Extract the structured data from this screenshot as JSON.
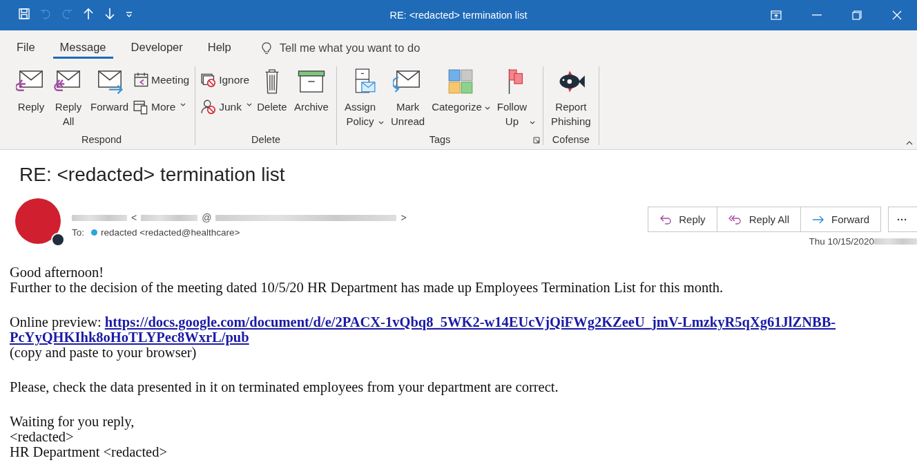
{
  "window": {
    "title": "RE: <redacted> termination list"
  },
  "quick_access": [
    {
      "kind": "save",
      "disabled": false
    },
    {
      "kind": "undo",
      "disabled": true
    },
    {
      "kind": "redo",
      "disabled": true
    },
    {
      "kind": "up",
      "disabled": false
    },
    {
      "kind": "down",
      "disabled": false
    },
    {
      "kind": "customize",
      "disabled": false
    }
  ],
  "menu_tabs": [
    {
      "label": "File",
      "selected": false
    },
    {
      "label": "Message",
      "selected": true
    },
    {
      "label": "Developer",
      "selected": false
    },
    {
      "label": "Help",
      "selected": false
    }
  ],
  "tell_me": {
    "placeholder": "Tell me what you want to do"
  },
  "ribbon_groups": [
    {
      "label": "Respond",
      "has_launcher": false,
      "items": [
        {
          "kind": "large",
          "label": "Reply",
          "dropdown": false
        },
        {
          "kind": "large",
          "label": "Reply All",
          "dropdown": false
        },
        {
          "kind": "large",
          "label": "Forward",
          "dropdown": false
        },
        {
          "kind": "stack",
          "items": [
            {
              "label": "Meeting",
              "dropdown": false
            },
            {
              "label": "More",
              "dropdown": true
            }
          ]
        }
      ]
    },
    {
      "label": "Delete",
      "has_launcher": false,
      "items": [
        {
          "kind": "stack",
          "items": [
            {
              "label": "Ignore",
              "dropdown": false
            },
            {
              "label": "Junk",
              "dropdown": true
            }
          ]
        },
        {
          "kind": "large",
          "label": "Delete",
          "dropdown": false
        },
        {
          "kind": "large",
          "label": "Archive",
          "dropdown": false
        }
      ]
    },
    {
      "label": "Tags",
      "has_launcher": true,
      "items": [
        {
          "kind": "large",
          "label": "Assign Policy",
          "dropdown": true
        },
        {
          "kind": "large",
          "label": "Mark Unread",
          "dropdown": false
        },
        {
          "kind": "large",
          "label": "Categorize",
          "dropdown": true
        },
        {
          "kind": "large",
          "label": "Follow Up",
          "dropdown": true
        }
      ]
    },
    {
      "label": "Cofense",
      "has_launcher": false,
      "items": [
        {
          "kind": "large",
          "label": "Report Phishing",
          "dropdown": false
        }
      ]
    }
  ],
  "message": {
    "subject": "RE: <redacted> termination list",
    "sender_symbols": [
      "<",
      "@",
      ">"
    ],
    "to_label": "To:",
    "recipient": {
      "name": "redacted <redacted@healthcare>",
      "color": "#2ea3e0"
    },
    "actions": [
      {
        "kind": "reply",
        "label": "Reply"
      },
      {
        "kind": "reply_all",
        "label": "Reply All"
      },
      {
        "kind": "forward",
        "label": "Forward"
      },
      {
        "kind": "more",
        "label": "···"
      }
    ],
    "date": "Thu 10/15/2020",
    "body": [
      {
        "kind": "text",
        "lines": [
          "Good afternoon!",
          "Further to the decision of the meeting dated 10/5/20 HR Department has made up Employees Termination List for this month."
        ]
      },
      {
        "kind": "link",
        "label": "Online preview:",
        "url_lines": [
          "https://docs.google.com/document/d/e/2PACX-1vQbq8_5WK2-w14EUcVjQiFWg2KZeeU_jmV-LmzkyR5qXg61JlZNBB-",
          "PcYyQHKIhk8oHoTLYPec8WxrL/pub"
        ],
        "lines": [
          "(copy and paste to your browser)"
        ]
      },
      {
        "kind": "text",
        "lines": [
          "Please, check the data presented in it on terminated employees from your department are correct."
        ]
      },
      {
        "kind": "text",
        "lines": [
          "Waiting for you reply,",
          "<redacted>",
          "HR Department <redacted>"
        ]
      }
    ]
  }
}
